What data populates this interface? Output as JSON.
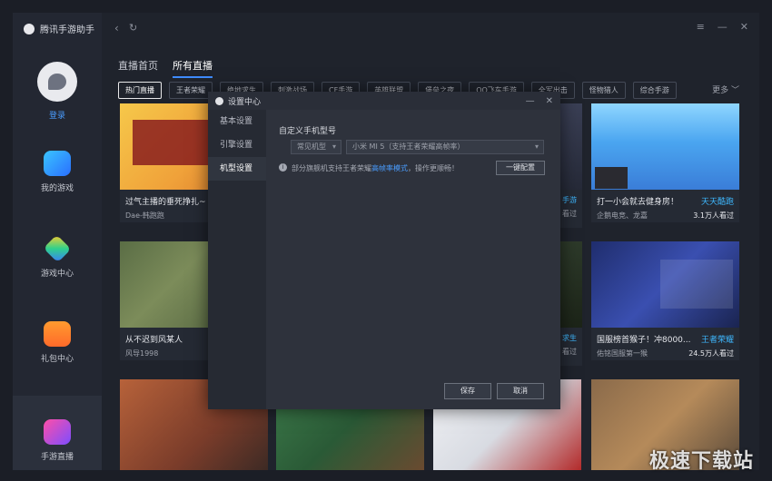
{
  "app": {
    "title": "腾讯手游助手"
  },
  "sidebar": {
    "login_label": "登录",
    "items": [
      {
        "label": "我的游戏",
        "icon": "gamepad-icon"
      },
      {
        "label": "游戏中心",
        "icon": "game-center-icon"
      },
      {
        "label": "礼包中心",
        "icon": "gift-icon"
      },
      {
        "label": "手游直播",
        "icon": "live-icon"
      }
    ]
  },
  "topbar": {
    "back": "‹",
    "refresh": "↻",
    "menu": "≡",
    "minimize": "—",
    "close": "✕"
  },
  "tabs": [
    {
      "label": "直播首页"
    },
    {
      "label": "所有直播"
    }
  ],
  "categories": [
    "热门直播",
    "王者荣耀",
    "绝地求生",
    "刺激战场",
    "CF手游",
    "英雄联盟",
    "堡垒之夜",
    "QQ飞车手游",
    "全军出击",
    "怪物猎人",
    "综合手游"
  ],
  "more_label": "更多 ﹀",
  "cards": [
    {
      "title": "过气主播的垂死挣扎~",
      "game": "",
      "streamer": "Dae-韩跑跑",
      "viewers": ""
    },
    {
      "title": "打一小会就去健身房！",
      "game": "天天酷跑",
      "streamer": "企鹅电竞、龙嘉",
      "viewers": "3.1万人看过"
    },
    {
      "title": "从不迟到风某人",
      "game": "",
      "streamer": "风导1998",
      "viewers": ""
    },
    {
      "title": "国服榜首猴子！冲8000...",
      "game": "王者荣耀",
      "streamer": "佑铭国服第一猴",
      "viewers": "24.5万人看过"
    }
  ],
  "partial_labels": [
    "手游",
    "看过",
    "求生",
    "看过"
  ],
  "dialog": {
    "title": "设置中心",
    "menu": [
      "基本设置",
      "引擎设置",
      "机型设置"
    ],
    "section_title": "自定义手机型号",
    "select_type": "常见机型",
    "select_model": "小米 MI 5（支持王者荣耀高帧率）",
    "note_prefix": "部分旗舰机支持王者荣耀",
    "note_link": "高帧率模式",
    "note_suffix": "，操作更顺畅！",
    "config_button": "一键配置",
    "save_button": "保存",
    "cancel_button": "取消"
  },
  "watermark": "极速下载站"
}
